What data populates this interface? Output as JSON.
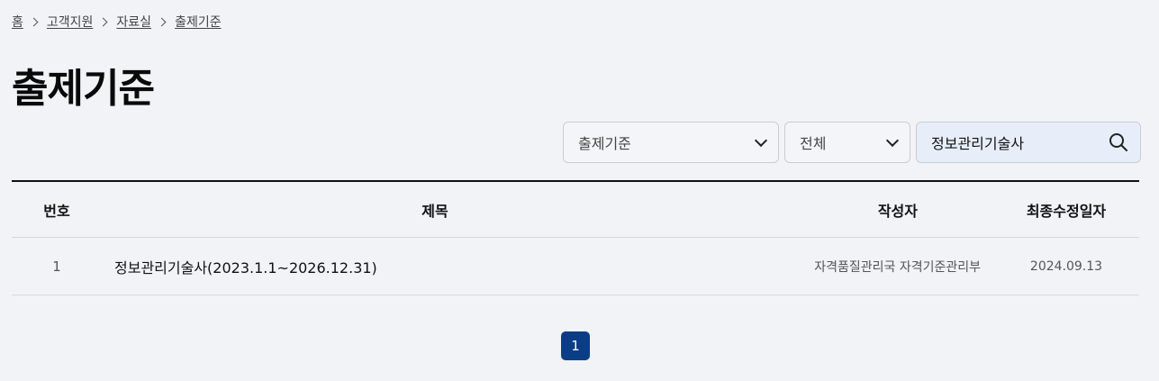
{
  "breadcrumb": {
    "items": [
      "홈",
      "고객지원",
      "자료실",
      "출제기준"
    ]
  },
  "page": {
    "title": "출제기준"
  },
  "filters": {
    "category": "출제기준",
    "scope": "전체",
    "search_value": "정보관리기술사",
    "search_icon": "search-icon",
    "dropdown_icon": "chevron-down-icon"
  },
  "table": {
    "headers": {
      "num": "번호",
      "title": "제목",
      "author": "작성자",
      "date": "최종수정일자"
    },
    "rows": [
      {
        "num": "1",
        "title": "정보관리기술사(2023.1.1~2026.12.31)",
        "author": "자격품질관리국 자격기준관리부",
        "date": "2024.09.13"
      }
    ]
  },
  "pagination": {
    "current": "1"
  },
  "colors": {
    "accent": "#0b3d86",
    "background": "#f1f3f7"
  }
}
